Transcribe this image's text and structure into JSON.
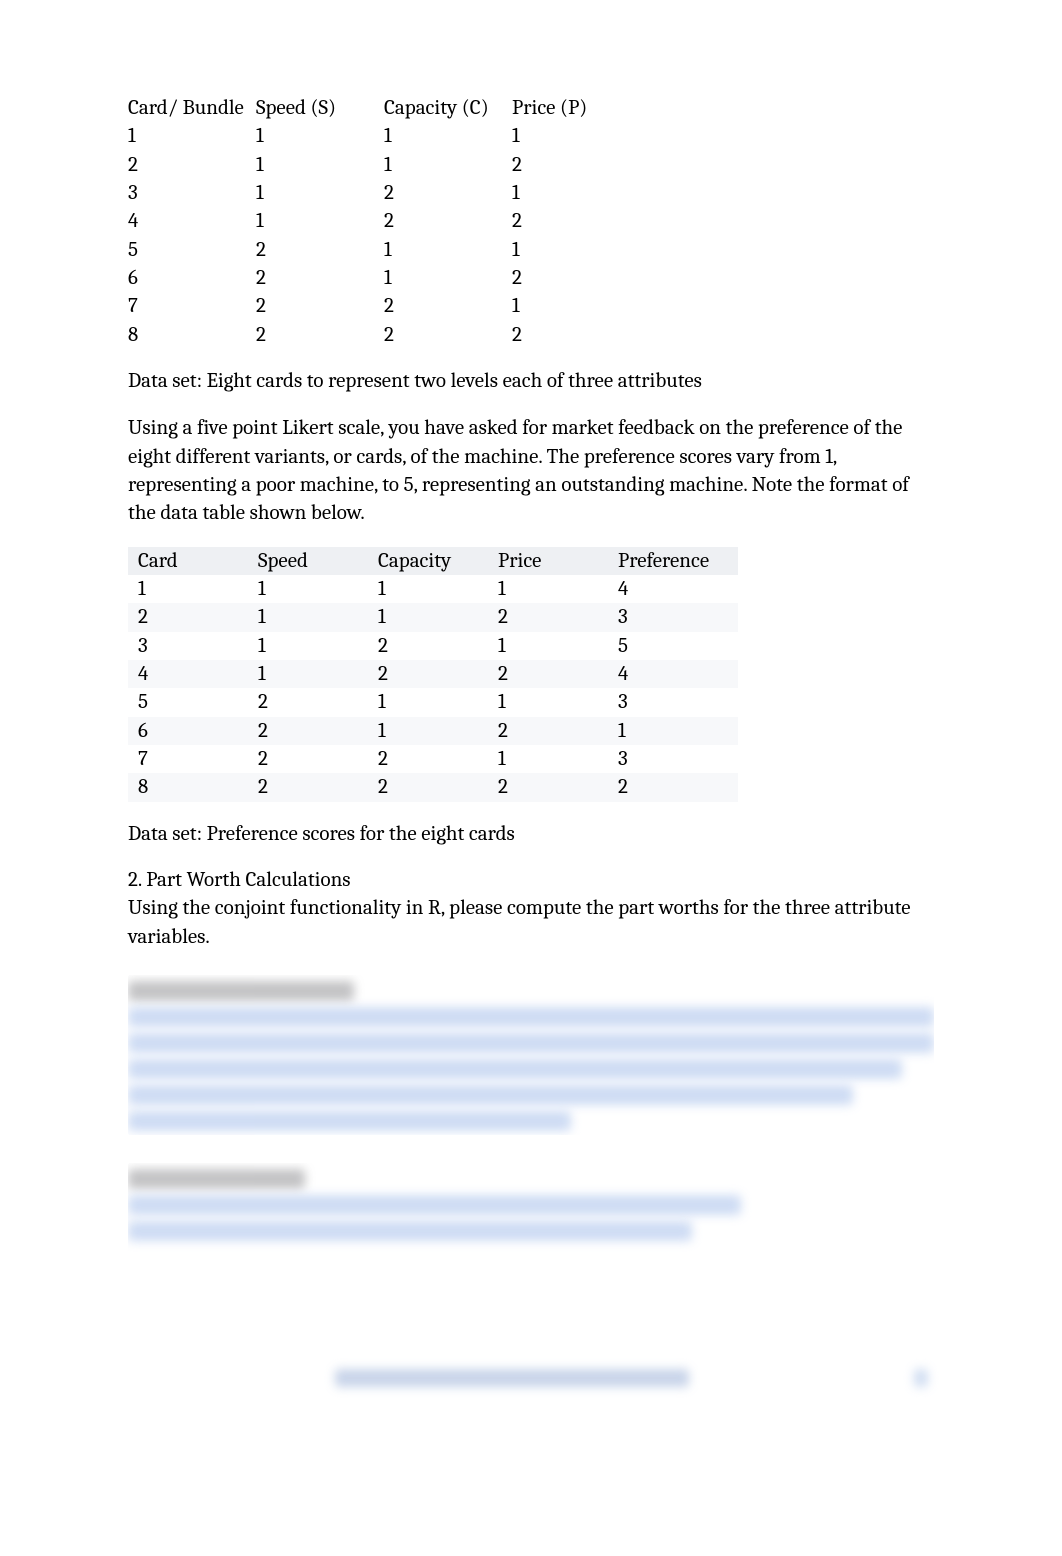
{
  "table1": {
    "headers": [
      "Card/ Bundle",
      "Speed (S)",
      "Capacity (C)",
      "Price (P)"
    ],
    "rows": [
      [
        "1",
        "1",
        "1",
        "1"
      ],
      [
        "2",
        "1",
        "1",
        "2"
      ],
      [
        "3",
        "1",
        "2",
        "1"
      ],
      [
        "4",
        "1",
        "2",
        "2"
      ],
      [
        "5",
        "2",
        "1",
        "1"
      ],
      [
        "6",
        "2",
        "1",
        "2"
      ],
      [
        "7",
        "2",
        "2",
        "1"
      ],
      [
        "8",
        "2",
        "2",
        "2"
      ]
    ],
    "caption": "Data set: Eight cards to represent two levels each of three attributes"
  },
  "para1": "Using a five point Likert scale, you have asked for market feedback on the preference of the eight different variants, or cards, of the machine. The preference scores vary from 1, representing a poor machine, to 5, representing an outstanding machine. Note the format of the data table shown below.",
  "table2": {
    "headers": [
      "Card",
      "Speed",
      "Capacity",
      "Price",
      "Preference"
    ],
    "rows": [
      [
        "1",
        "1",
        "1",
        "1",
        "4"
      ],
      [
        "2",
        "1",
        "1",
        "2",
        "3"
      ],
      [
        "3",
        "1",
        "2",
        "1",
        "5"
      ],
      [
        "4",
        "1",
        "2",
        "2",
        "4"
      ],
      [
        "5",
        "2",
        "1",
        "1",
        "3"
      ],
      [
        "6",
        "2",
        "1",
        "2",
        "1"
      ],
      [
        "7",
        "2",
        "2",
        "1",
        "3"
      ],
      [
        "8",
        "2",
        "2",
        "2",
        "2"
      ]
    ],
    "caption": "Data set: Preference scores for the eight cards"
  },
  "heading2": "2. Part Worth Calculations",
  "para2": "Using the conjoint functionality in R, please compute the part worths for the three attribute variables.",
  "chart_data": {
    "type": "table",
    "tables": [
      {
        "title": "Eight cards to represent two levels each of three attributes",
        "columns": [
          "Card/Bundle",
          "Speed (S)",
          "Capacity (C)",
          "Price (P)"
        ],
        "rows": [
          [
            1,
            1,
            1,
            1
          ],
          [
            2,
            1,
            1,
            2
          ],
          [
            3,
            1,
            2,
            1
          ],
          [
            4,
            1,
            2,
            2
          ],
          [
            5,
            2,
            1,
            1
          ],
          [
            6,
            2,
            1,
            2
          ],
          [
            7,
            2,
            2,
            1
          ],
          [
            8,
            2,
            2,
            2
          ]
        ]
      },
      {
        "title": "Preference scores for the eight cards",
        "columns": [
          "Card",
          "Speed",
          "Capacity",
          "Price",
          "Preference"
        ],
        "rows": [
          [
            1,
            1,
            1,
            1,
            4
          ],
          [
            2,
            1,
            1,
            2,
            3
          ],
          [
            3,
            1,
            2,
            1,
            5
          ],
          [
            4,
            1,
            2,
            2,
            4
          ],
          [
            5,
            2,
            1,
            1,
            3
          ],
          [
            6,
            2,
            1,
            2,
            1
          ],
          [
            7,
            2,
            2,
            1,
            3
          ],
          [
            8,
            2,
            2,
            2,
            2
          ]
        ]
      }
    ]
  }
}
